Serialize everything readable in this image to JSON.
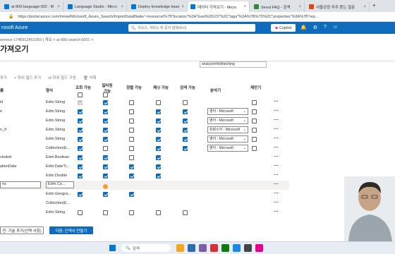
{
  "browser": {
    "tabs": [
      {
        "label": "ai-900-language-002 - M"
      },
      {
        "label": "Language Studio - Micro"
      },
      {
        "label": "Deploy knowledge base"
      },
      {
        "label": "데이터 가져오기 - Micro"
      },
      {
        "label": "Seoul FAQ - 검색"
      },
      {
        "label": "서울관광 자주 묻는 질문"
      }
    ],
    "url": "https://portal.azure.com/#view/Microsoft_Azure_Search/ImportDataBlade/~/resource/%7B\"location\"%3A\"East%20US\"%2C\"tags\"%3A%7B%7D%2C\"properties\"%3A%7B\"rep..."
  },
  "portal": {
    "brand": "rosoft Azure",
    "search_placeholder": "리소스, 서비스 및 문서 검색(G+/)",
    "copilot": "Copilot",
    "header_icons": [
      "bell-icon",
      "gear-icon",
      "help-icon",
      "feedback-icon"
    ]
  },
  "breadcrumb": "service-1745912451093 | 개요 > ai-900-search-0001 >",
  "page_title": "가져오기",
  "analyzer_field": "analyzeInfixMatching",
  "toolbar": {
    "add": "추가",
    "add_subfield": "+ 하위 필드 추가",
    "set_subfield": "⇄ 하위 필드 구성",
    "delete": "🗑 삭제"
  },
  "columns": {
    "name": "름",
    "type": "형식",
    "retrievable": "조회 가능",
    "filterable": "필터링 가능",
    "sortable": "정렬 가능",
    "facetable": "패싯 가능",
    "searchable": "검색 가능",
    "analyzer": "분석기",
    "suggester": "제안기"
  },
  "rows": [
    {
      "name": "id",
      "type": "Edm.String",
      "flags": [
        "dis",
        "on",
        "off",
        "off",
        "off"
      ],
      "analyzer": "",
      "suggest": "off"
    },
    {
      "name": "e",
      "type": "Edm.String",
      "flags": [
        "on",
        "on",
        "off",
        "on",
        "on"
      ],
      "analyzer": "영어 - Microsoft",
      "suggest": "off"
    },
    {
      "name": "",
      "type": "Edm.String",
      "flags": [
        "on",
        "on",
        "off",
        "on",
        "on"
      ],
      "analyzer": "영어 - Microsoft",
      "suggest": "off"
    },
    {
      "name": "n_fr",
      "type": "Edm.String",
      "flags": [
        "on",
        "on",
        "off",
        "on",
        "on"
      ],
      "analyzer": "프랑스어 - Microsoft",
      "suggest": "off"
    },
    {
      "name": "",
      "type": "Edm.String",
      "flags": [
        "on",
        "on",
        "off",
        "on",
        "on"
      ],
      "analyzer": "영어 - Microsoft",
      "suggest": "off"
    },
    {
      "name": "",
      "type": "Collection(E...",
      "flags": [
        "on",
        "off",
        "off",
        "on",
        "on"
      ],
      "analyzer": "영어 - Microsoft",
      "suggest": "off"
    },
    {
      "name": "cluded",
      "type": "Edm.Boolean",
      "flags": [
        "on",
        "on",
        "off",
        "on",
        "none"
      ],
      "analyzer": "",
      "suggest": "none"
    },
    {
      "name": "ationDate",
      "type": "Edm.DateTi...",
      "flags": [
        "on",
        "on",
        "on",
        "on",
        "none"
      ],
      "analyzer": "",
      "suggest": "none"
    },
    {
      "name": "",
      "type": "Edm.Double",
      "flags": [
        "on",
        "on",
        "on",
        "on",
        "none"
      ],
      "analyzer": "",
      "suggest": "none"
    },
    {
      "name": "ns",
      "type": "Edm.Co...",
      "flags": [
        "none",
        "none",
        "none",
        "none",
        "none"
      ],
      "analyzer": "",
      "suggest": "none",
      "highlight": true
    },
    {
      "name": "",
      "type": "Edm.Geogra...",
      "flags": [
        "on",
        "on",
        "on",
        "none",
        "none"
      ],
      "analyzer": "",
      "suggest": "none"
    },
    {
      "name": "",
      "type": "Collection(E...",
      "flags": [
        "none",
        "none",
        "none",
        "none",
        "none"
      ],
      "analyzer": "",
      "suggest": "none"
    },
    {
      "name": "",
      "type": "Edm.String",
      "flags": [
        "off",
        "off",
        "off",
        "off",
        "off"
      ],
      "analyzer": "",
      "suggest": "none"
    }
  ],
  "buttons": {
    "previous": "전: 기술 추가(선택 사항)",
    "next": "다음: 인덱서 만들기"
  },
  "taskbar": {
    "search": "검색"
  }
}
